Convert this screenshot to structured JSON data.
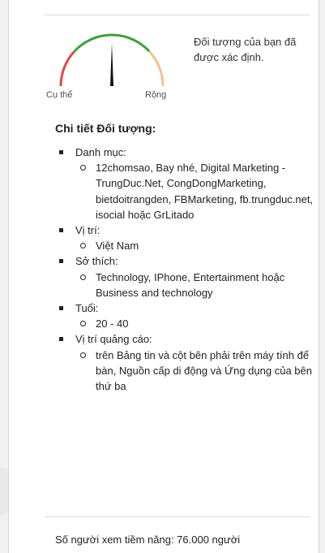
{
  "gauge": {
    "left_label": "Cụ thể",
    "right_label": "Rộng",
    "description": "Đối tượng của bạn đã được xác định.",
    "colors": {
      "specific": "#e04848",
      "defined": "#3f9e3a",
      "broad": "#f4c18a",
      "needle": "#111111"
    }
  },
  "details": {
    "title": "Chi tiết Đối tượng:",
    "items": [
      {
        "label": "Danh mục:",
        "values": [
          "12chomsao, Bay nhé, Digital Marketing - TrungDuc.Net, CongDongMarketing, bietdoitrangden, FBMarketing, fb.trungduc.net, isocial hoặc GrLitado"
        ]
      },
      {
        "label": "Vị trí:",
        "values": [
          "Việt Nam"
        ]
      },
      {
        "label": "Sở thích:",
        "values": [
          "Technology, IPhone, Entertainment hoặc Business and technology"
        ]
      },
      {
        "label": "Tuổi:",
        "values": [
          "20 - 40"
        ]
      },
      {
        "label": "Vị trí quảng cáo:",
        "values": [
          "trên Bảng tin và cột bên phải trên máy tính để bàn, Nguồn cấp di động và Ứng dụng của bên thứ ba"
        ]
      }
    ]
  },
  "reach": {
    "text": "Số người xem tiềm năng: 76.000 người"
  }
}
